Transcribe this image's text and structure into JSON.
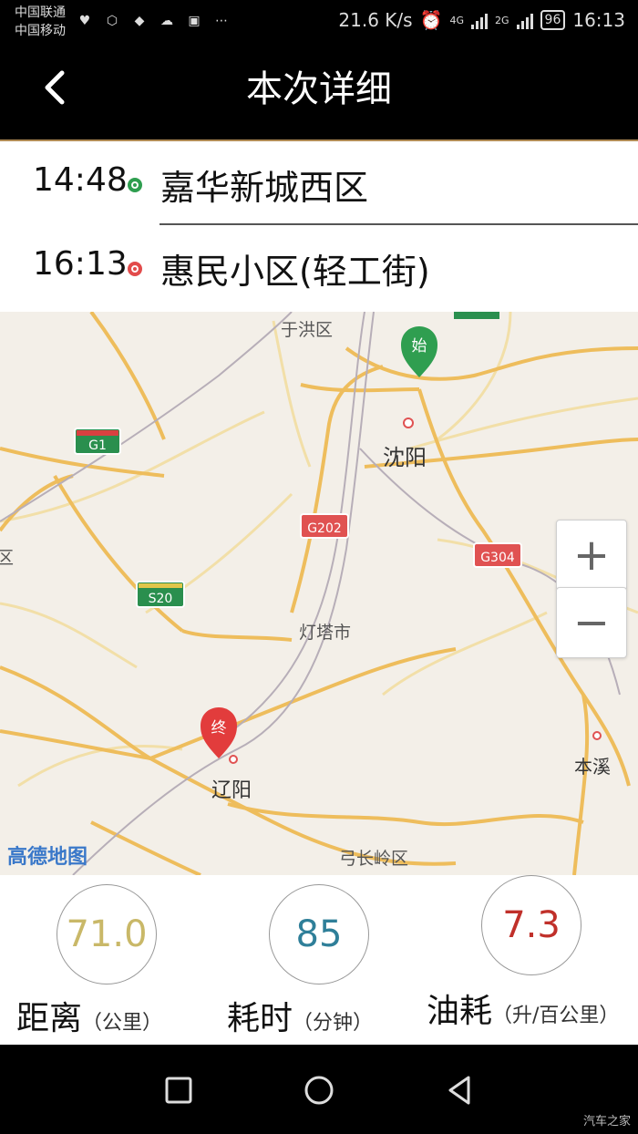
{
  "status_bar": {
    "carrier_1": "中国联通",
    "carrier_2": "中国移动",
    "net_speed": "21.6 K/s",
    "net_4g": "4G",
    "net_2g": "2G",
    "battery": "96",
    "time": "16:13"
  },
  "header": {
    "title": "本次详细"
  },
  "route": {
    "start": {
      "time": "14:48",
      "place": "嘉华新城西区",
      "dot_color": "#2e9e4f"
    },
    "end": {
      "time": "16:13",
      "place": "惠民小区(轻工街)",
      "dot_color": "#e24b4b"
    }
  },
  "map": {
    "labels": {
      "yuhong": "于洪区",
      "shenyang": "沈阳",
      "dengta": "灯塔市",
      "liaoyang": "辽阳",
      "benxi": "本溪",
      "gongchangling": "弓长岭区",
      "left_edge": "区"
    },
    "shields": {
      "g1": "G1",
      "s20": "S20",
      "g202": "G202",
      "g304": "G304"
    },
    "markers": {
      "start": "始",
      "end": "终"
    },
    "logo": "高德地图",
    "zoom_in": "+",
    "zoom_out": "−"
  },
  "stats": {
    "distance": {
      "value": "71.0",
      "label": "距离",
      "unit": "（公里）",
      "color": "#c9b868"
    },
    "duration": {
      "value": "85",
      "label": "耗时",
      "unit": "（分钟）",
      "color": "#2f7f99"
    },
    "fuel": {
      "value": "7.3",
      "label": "油耗",
      "unit": "（升/百公里）",
      "color": "#c0302a"
    }
  },
  "watermark": "汽车之家"
}
